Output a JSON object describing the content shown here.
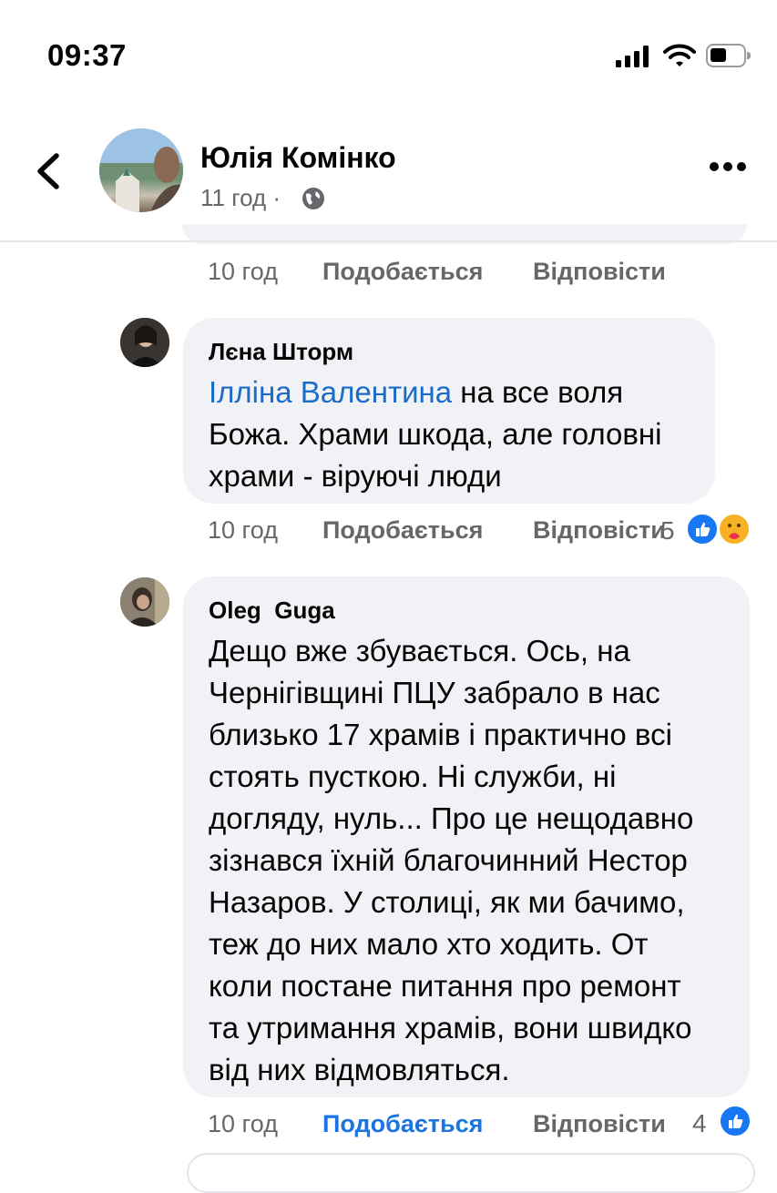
{
  "status_bar": {
    "time": "09:37"
  },
  "header": {
    "author": "Юлія Комінко",
    "time": "11 год",
    "separator": "·"
  },
  "top_actions": {
    "time": "10 год",
    "like": "Подобається",
    "reply": "Відповісти"
  },
  "comments": [
    {
      "author": "Лєна Шторм",
      "mention": "Ілліна Валентина",
      "text_lines": [
        "на все воля",
        "Божа. Храми шкода, але головні",
        "храми - віруючі люди"
      ],
      "time": "10 год",
      "like": "Подобається",
      "reply": "Відповісти",
      "reactions_count": "5",
      "reactions": [
        "like-icon",
        "care-icon"
      ]
    },
    {
      "author": "Oleg  Guga",
      "text_lines": [
        "Дещо вже збувається. Ось, на",
        "Чернігівщині ПЦУ забрало в нас",
        "близько 17 храмів і практично всі",
        "стоять пусткою. Ні служби, ні",
        "догляду, нуль... Про це нещодавно",
        "зізнався їхній благочинний Нестор",
        "Назаров. У столиці, як ми бачимо,",
        "теж до них мало хто ходить. От",
        "коли постане питання про ремонт",
        "та утримання храмів, вони швидко",
        "від них відмовляться."
      ],
      "time": "10 год",
      "like": "Подобається",
      "like_active": true,
      "reply": "Відповісти",
      "reactions_count": "4",
      "reactions": [
        "like-icon"
      ]
    }
  ],
  "colors": {
    "accent": "#1877f2",
    "bubble": "#f0f2f5",
    "meta": "#65676b"
  }
}
